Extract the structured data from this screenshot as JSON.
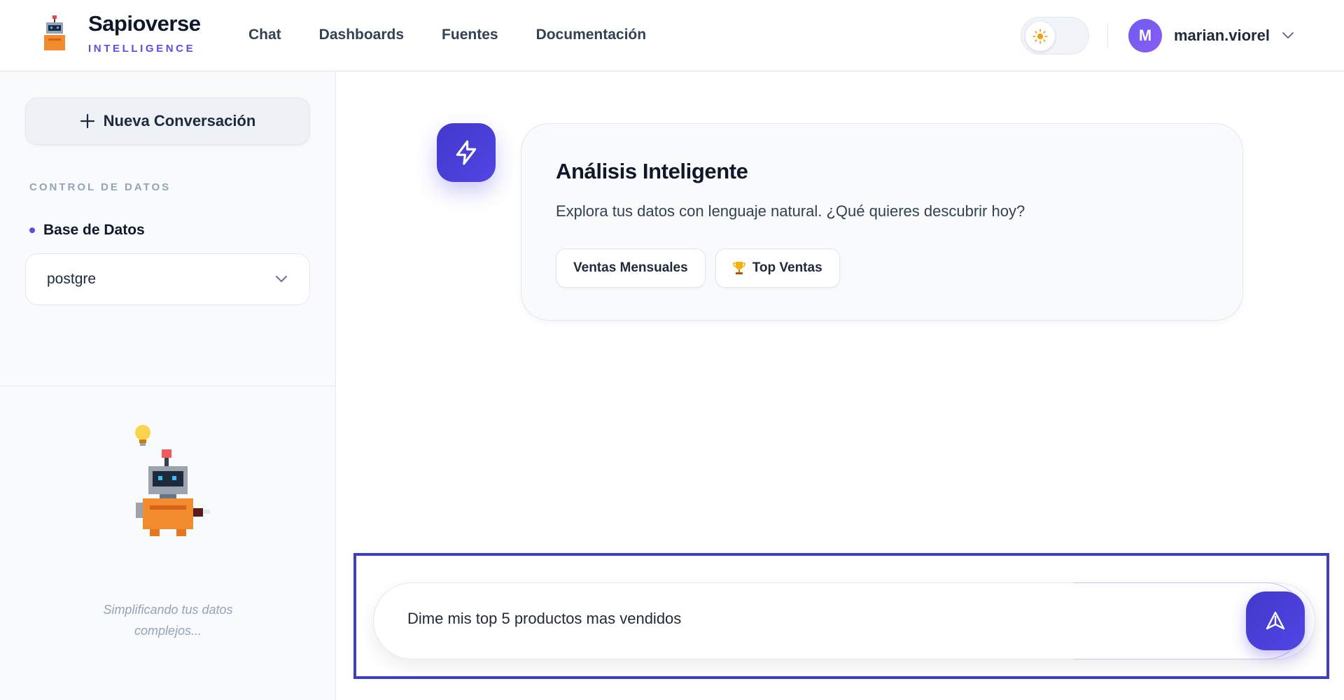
{
  "brand": {
    "name": "Sapioverse",
    "subtitle": "INTELLIGENCE"
  },
  "nav": {
    "items": [
      {
        "label": "Chat"
      },
      {
        "label": "Dashboards"
      },
      {
        "label": "Fuentes"
      },
      {
        "label": "Documentación"
      }
    ]
  },
  "user": {
    "initial": "M",
    "name": "marian.viorel"
  },
  "sidebar": {
    "new_conversation": "Nueva Conversación",
    "section_title": "CONTROL DE DATOS",
    "db_label": "Base de Datos",
    "db_selected": "postgre",
    "tagline": "Simplificando tus datos complejos..."
  },
  "main": {
    "card_title": "Análisis Inteligente",
    "card_desc": "Explora tus datos con lenguaje natural. ¿Qué quieres descubrir hoy?",
    "suggestions": [
      {
        "label": "Ventas Mensuales"
      },
      {
        "label": "Top Ventas",
        "icon": "trophy-icon"
      }
    ]
  },
  "input": {
    "value": "Dime mis top 5 productos mas vendidos"
  },
  "colors": {
    "accent": "#4f46e5",
    "brand_sub": "#5b4de0"
  }
}
